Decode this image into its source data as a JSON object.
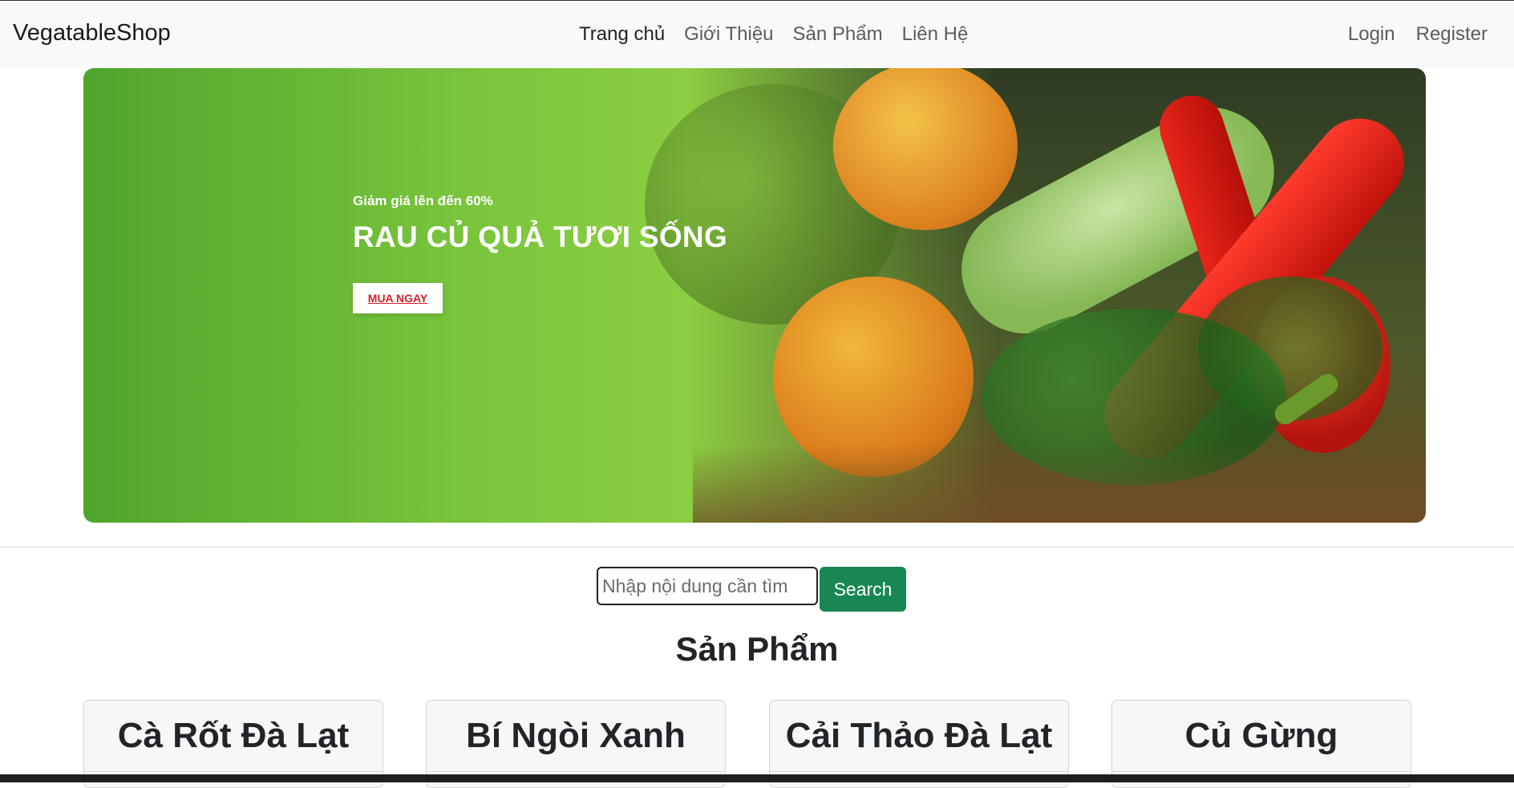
{
  "navbar": {
    "brand": "VegatableShop",
    "links": [
      "Trang chủ",
      "Giới Thiệu",
      "Sản Phẩm",
      "Liên Hệ"
    ],
    "auth": [
      "Login",
      "Register"
    ]
  },
  "hero": {
    "subtitle": "Giảm giá lên đến 60%",
    "title": "RAU CỦ QUẢ TƯƠI SỐNG",
    "button": "MUA NGAY"
  },
  "search": {
    "placeholder": "Nhập nội dung cần tìm",
    "button": "Search"
  },
  "products": {
    "heading": "Sản Phẩm",
    "items": [
      "Cà Rốt Đà Lạt",
      "Bí Ngòi Xanh",
      "Cải Thảo Đà Lạt",
      "Củ Gừng"
    ]
  },
  "colors": {
    "navbar_bg": "#f8f9fa",
    "hero_green": "#8cce41",
    "search_button": "#198754",
    "hero_button_text": "#d2232b"
  }
}
